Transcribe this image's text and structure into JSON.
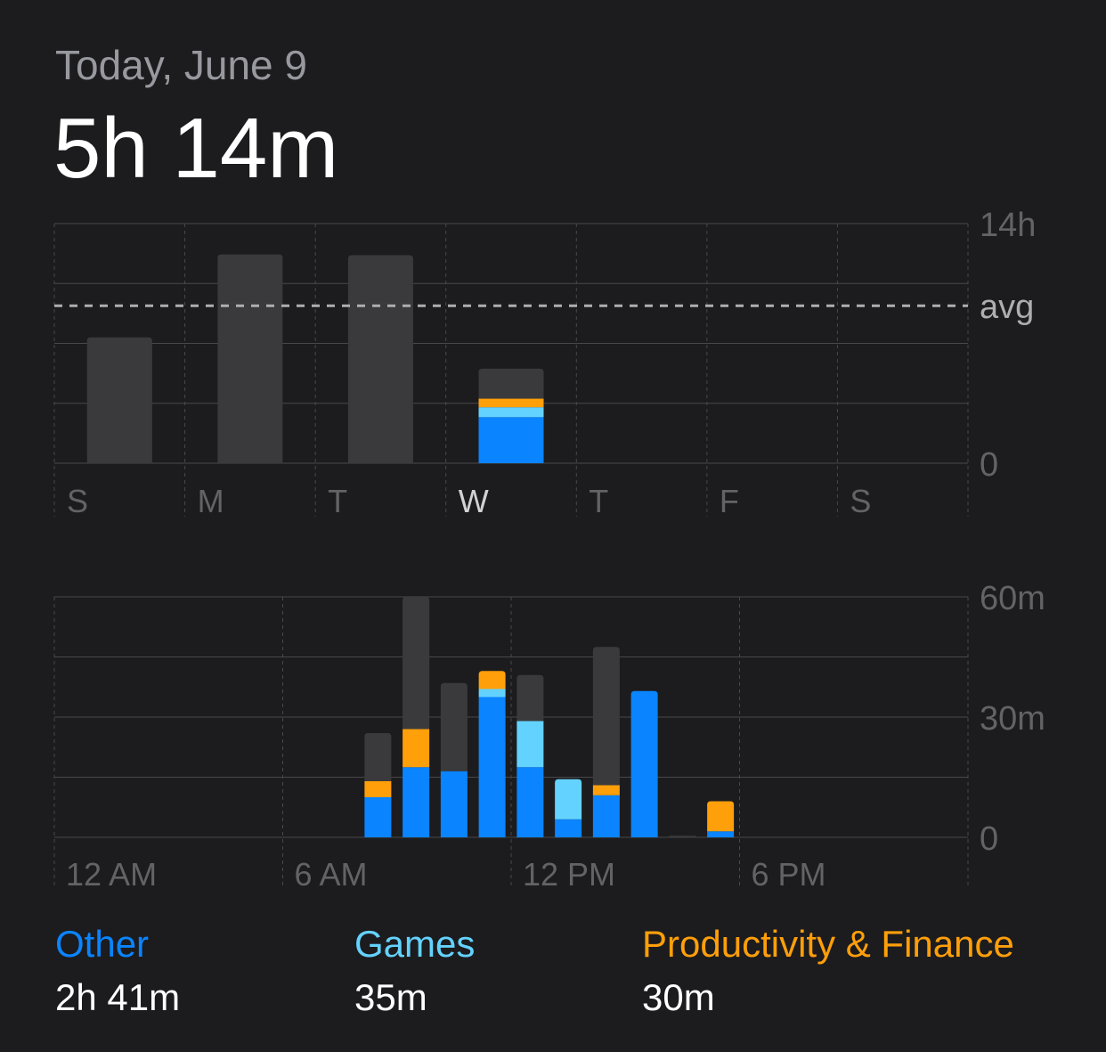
{
  "header": {
    "date_label": "Today, June 9",
    "total_time": "5h 14m"
  },
  "colors": {
    "background": "#1c1c1e",
    "other": "#0a84ff",
    "games": "#64d2ff",
    "productivity": "#ff9f0a",
    "uncategorized": "#3a3a3c",
    "grid": "#48484a",
    "axis_text": "#636366",
    "avg_line": "#aeaeb2"
  },
  "chart_data": [
    {
      "type": "bar",
      "title": "",
      "categories": [
        "S",
        "M",
        "T",
        "W",
        "T",
        "F",
        "S"
      ],
      "highlighted_category_index": 3,
      "series": [
        {
          "key": "other",
          "values": [
            0,
            0,
            0,
            2.69,
            0,
            0,
            0
          ]
        },
        {
          "key": "games",
          "values": [
            0,
            0,
            0,
            0.58,
            0,
            0,
            0
          ]
        },
        {
          "key": "productivity",
          "values": [
            0,
            0,
            0,
            0.5,
            0,
            0,
            0
          ]
        },
        {
          "key": "uncategorized",
          "values": [
            7.35,
            12.2,
            12.15,
            1.75,
            0,
            0,
            0
          ]
        }
      ],
      "ylim": [
        0,
        14
      ],
      "y_tick_labels": [
        "14h",
        "0"
      ],
      "average": 9.2,
      "average_label": "avg"
    },
    {
      "type": "bar",
      "title": "",
      "x_tick_labels": [
        "12 AM",
        "6 AM",
        "12 PM",
        "6 PM"
      ],
      "hours": [
        8,
        9,
        10,
        11,
        12,
        13,
        14,
        15,
        16,
        17
      ],
      "series": [
        {
          "key": "other",
          "values": [
            10,
            17.5,
            16.5,
            35,
            17.5,
            4.5,
            10.5,
            36.5,
            0,
            1.5
          ]
        },
        {
          "key": "games",
          "values": [
            0,
            0,
            0,
            2,
            11.5,
            10,
            0,
            0,
            0,
            0
          ]
        },
        {
          "key": "productivity",
          "values": [
            4,
            9.5,
            0,
            4.5,
            0,
            0,
            2.5,
            0,
            0,
            7.5
          ]
        },
        {
          "key": "uncategorized",
          "values": [
            12,
            33,
            22,
            0,
            11.5,
            0,
            34.5,
            0,
            0.4,
            0
          ]
        }
      ],
      "ylim": [
        0,
        60
      ],
      "y_tick_labels": [
        "60m",
        "30m",
        "0"
      ]
    }
  ],
  "legend": [
    {
      "label": "Other",
      "value": "2h 41m",
      "color_key": "other"
    },
    {
      "label": "Games",
      "value": "35m",
      "color_key": "games"
    },
    {
      "label": "Productivity & Finance",
      "value": "30m",
      "color_key": "productivity"
    }
  ]
}
